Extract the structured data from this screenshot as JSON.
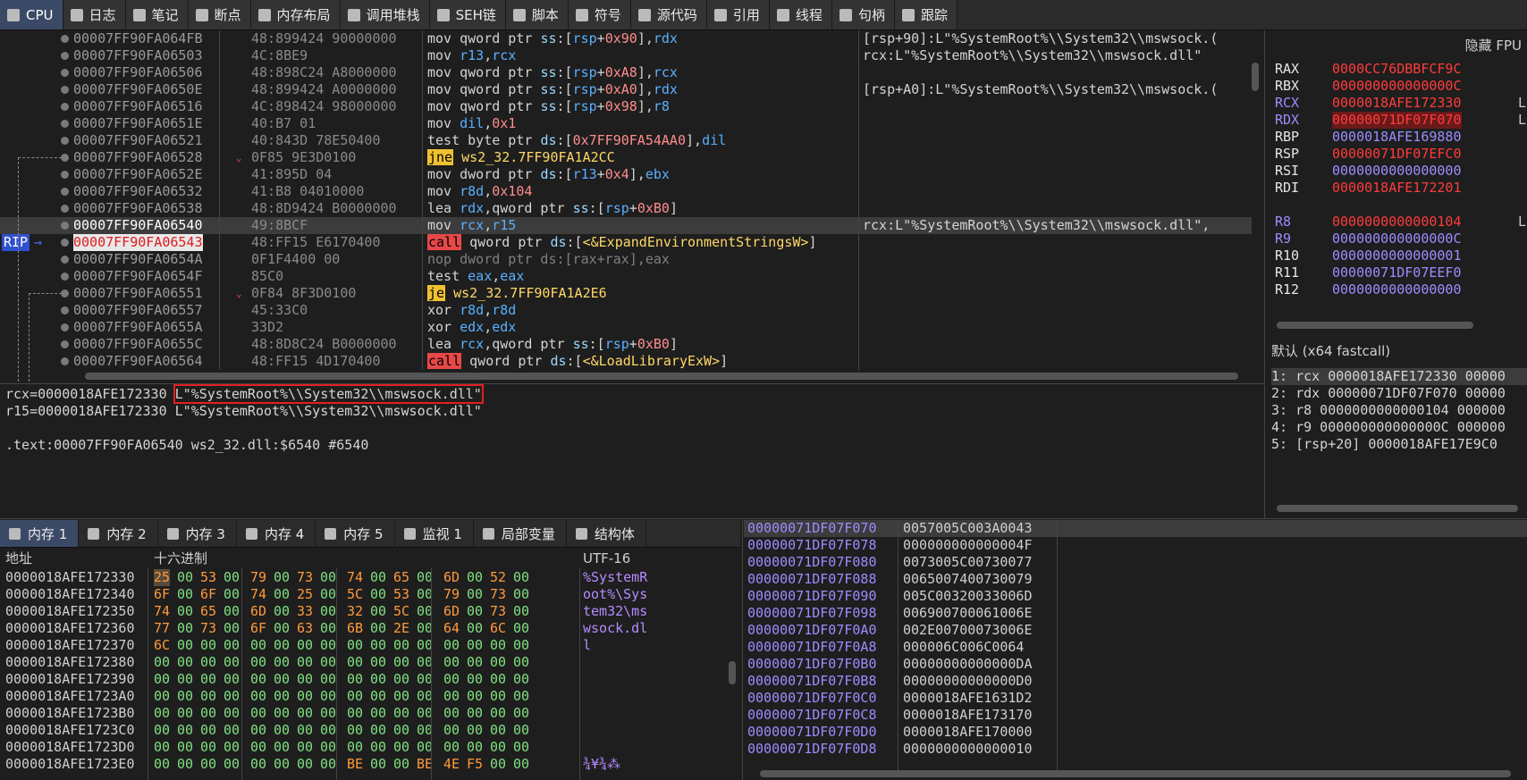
{
  "tabs": [
    {
      "label": "CPU",
      "icon": "cpu-icon",
      "active": true
    },
    {
      "label": "日志",
      "icon": "log-icon"
    },
    {
      "label": "笔记",
      "icon": "notes-icon"
    },
    {
      "label": "断点",
      "icon": "breakpoint-icon"
    },
    {
      "label": "内存布局",
      "icon": "memory-map-icon"
    },
    {
      "label": "调用堆栈",
      "icon": "call-stack-icon"
    },
    {
      "label": "SEH链",
      "icon": "seh-icon"
    },
    {
      "label": "脚本",
      "icon": "script-icon"
    },
    {
      "label": "符号",
      "icon": "symbol-icon"
    },
    {
      "label": "源代码",
      "icon": "source-icon"
    },
    {
      "label": "引用",
      "icon": "reference-icon"
    },
    {
      "label": "线程",
      "icon": "thread-icon"
    },
    {
      "label": "句柄",
      "icon": "handle-icon"
    },
    {
      "label": "跟踪",
      "icon": "trace-icon"
    }
  ],
  "disasm": [
    {
      "addr": "00007FF90FA064FB",
      "bytes": "48:899424 90000000",
      "instr": [
        [
          "mn",
          "mov "
        ],
        [
          "mn",
          "qword ptr "
        ],
        [
          "op-seg",
          "ss"
        ],
        [
          "mn",
          ":["
        ],
        [
          "op-reg",
          "rsp"
        ],
        [
          "mn",
          "+"
        ],
        [
          "op-num",
          "0x90"
        ],
        [
          "mn",
          "],"
        ],
        [
          "op-reg",
          "rdx"
        ]
      ],
      "comment": "[rsp+90]:L\"%SystemRoot%\\\\System32\\\\mswsock.("
    },
    {
      "addr": "00007FF90FA06503",
      "bytes": "4C:8BE9",
      "instr": [
        [
          "mn",
          "mov "
        ],
        [
          "op-reg",
          "r13"
        ],
        [
          "mn",
          ","
        ],
        [
          "op-reg",
          "rcx"
        ]
      ],
      "comment": "rcx:L\"%SystemRoot%\\\\System32\\\\mswsock.dll\""
    },
    {
      "addr": "00007FF90FA06506",
      "bytes": "48:898C24 A8000000",
      "instr": [
        [
          "mn",
          "mov "
        ],
        [
          "mn",
          "qword ptr "
        ],
        [
          "op-seg",
          "ss"
        ],
        [
          "mn",
          ":["
        ],
        [
          "op-reg",
          "rsp"
        ],
        [
          "mn",
          "+"
        ],
        [
          "op-num",
          "0xA8"
        ],
        [
          "mn",
          "],"
        ],
        [
          "op-reg",
          "rcx"
        ]
      ],
      "comment": ""
    },
    {
      "addr": "00007FF90FA0650E",
      "bytes": "48:899424 A0000000",
      "instr": [
        [
          "mn",
          "mov "
        ],
        [
          "mn",
          "qword ptr "
        ],
        [
          "op-seg",
          "ss"
        ],
        [
          "mn",
          ":["
        ],
        [
          "op-reg",
          "rsp"
        ],
        [
          "mn",
          "+"
        ],
        [
          "op-num",
          "0xA0"
        ],
        [
          "mn",
          "],"
        ],
        [
          "op-reg",
          "rdx"
        ]
      ],
      "comment": "[rsp+A0]:L\"%SystemRoot%\\\\System32\\\\mswsock.("
    },
    {
      "addr": "00007FF90FA06516",
      "bytes": "4C:898424 98000000",
      "instr": [
        [
          "mn",
          "mov "
        ],
        [
          "mn",
          "qword ptr "
        ],
        [
          "op-seg",
          "ss"
        ],
        [
          "mn",
          ":["
        ],
        [
          "op-reg",
          "rsp"
        ],
        [
          "mn",
          "+"
        ],
        [
          "op-num",
          "0x98"
        ],
        [
          "mn",
          "],"
        ],
        [
          "op-reg",
          "r8"
        ]
      ],
      "comment": ""
    },
    {
      "addr": "00007FF90FA0651E",
      "bytes": "40:B7 01",
      "instr": [
        [
          "mn",
          "mov "
        ],
        [
          "op-reg",
          "dil"
        ],
        [
          "mn",
          ","
        ],
        [
          "op-num",
          "0x1"
        ]
      ],
      "comment": ""
    },
    {
      "addr": "00007FF90FA06521",
      "bytes": "40:843D 78E50400",
      "instr": [
        [
          "mn",
          "test "
        ],
        [
          "mn",
          "byte ptr "
        ],
        [
          "op-seg",
          "ds"
        ],
        [
          "mn",
          ":["
        ],
        [
          "op-num",
          "0x7FF90FA54AA0"
        ],
        [
          "mn",
          "],"
        ],
        [
          "op-reg",
          "dil"
        ]
      ],
      "comment": ""
    },
    {
      "addr": "00007FF90FA06528",
      "bytes": "0F85 9E3D0100",
      "instr": [
        [
          "mn-ctrl",
          "jne"
        ],
        [
          "mn",
          " "
        ],
        [
          "op-yellow",
          "ws2_32.7FF90FA1A2CC"
        ]
      ],
      "comment": "",
      "arrow": "down"
    },
    {
      "addr": "00007FF90FA0652E",
      "bytes": "41:895D 04",
      "instr": [
        [
          "mn",
          "mov "
        ],
        [
          "mn",
          "dword ptr "
        ],
        [
          "op-seg",
          "ds"
        ],
        [
          "mn",
          ":["
        ],
        [
          "op-reg",
          "r13"
        ],
        [
          "mn",
          "+"
        ],
        [
          "op-num",
          "0x4"
        ],
        [
          "mn",
          "],"
        ],
        [
          "op-reg",
          "ebx"
        ]
      ],
      "comment": ""
    },
    {
      "addr": "00007FF90FA06532",
      "bytes": "41:B8 04010000",
      "instr": [
        [
          "mn",
          "mov "
        ],
        [
          "op-reg",
          "r8d"
        ],
        [
          "mn",
          ","
        ],
        [
          "op-num",
          "0x104"
        ]
      ],
      "comment": ""
    },
    {
      "addr": "00007FF90FA06538",
      "bytes": "48:8D9424 B0000000",
      "instr": [
        [
          "mn",
          "lea "
        ],
        [
          "op-reg",
          "rdx"
        ],
        [
          "mn",
          ",qword ptr "
        ],
        [
          "op-seg",
          "ss"
        ],
        [
          "mn",
          ":["
        ],
        [
          "op-reg",
          "rsp"
        ],
        [
          "mn",
          "+"
        ],
        [
          "op-num",
          "0xB0"
        ],
        [
          "mn",
          "]"
        ]
      ],
      "comment": ""
    },
    {
      "addr": "00007FF90FA06540",
      "bytes": "49:8BCF",
      "instr": [
        [
          "mn",
          "mov "
        ],
        [
          "op-reg",
          "rcx"
        ],
        [
          "mn",
          ","
        ],
        [
          "op-reg",
          "r15"
        ]
      ],
      "comment": "rcx:L\"%SystemRoot%\\\\System32\\\\mswsock.dll\",",
      "selected": true
    },
    {
      "addr": "00007FF90FA06543",
      "bytes": "48:FF15 E6170400",
      "instr": [
        [
          "mn-call",
          "call"
        ],
        [
          "mn",
          " qword ptr "
        ],
        [
          "op-seg",
          "ds"
        ],
        [
          "mn",
          ":["
        ],
        [
          "op-yellow",
          "<&ExpandEnvironmentStringsW>"
        ],
        [
          "mn",
          "]"
        ]
      ],
      "comment": "",
      "rip": true
    },
    {
      "addr": "00007FF90FA0654A",
      "bytes": "0F1F4400 00",
      "instr": [
        [
          "mn-gray",
          "nop dword ptr ds:[rax+rax],eax"
        ]
      ],
      "comment": ""
    },
    {
      "addr": "00007FF90FA0654F",
      "bytes": "85C0",
      "instr": [
        [
          "mn",
          "test "
        ],
        [
          "op-reg",
          "eax"
        ],
        [
          "mn",
          ","
        ],
        [
          "op-reg",
          "eax"
        ]
      ],
      "comment": ""
    },
    {
      "addr": "00007FF90FA06551",
      "bytes": "0F84 8F3D0100",
      "instr": [
        [
          "mn-ctrl",
          "je"
        ],
        [
          "mn",
          " "
        ],
        [
          "op-yellow",
          "ws2_32.7FF90FA1A2E6"
        ]
      ],
      "comment": "",
      "arrow": "down"
    },
    {
      "addr": "00007FF90FA06557",
      "bytes": "45:33C0",
      "instr": [
        [
          "mn",
          "xor "
        ],
        [
          "op-reg",
          "r8d"
        ],
        [
          "mn",
          ","
        ],
        [
          "op-reg",
          "r8d"
        ]
      ],
      "comment": ""
    },
    {
      "addr": "00007FF90FA0655A",
      "bytes": "33D2",
      "instr": [
        [
          "mn",
          "xor "
        ],
        [
          "op-reg",
          "edx"
        ],
        [
          "mn",
          ","
        ],
        [
          "op-reg",
          "edx"
        ]
      ],
      "comment": ""
    },
    {
      "addr": "00007FF90FA0655C",
      "bytes": "48:8D8C24 B0000000",
      "instr": [
        [
          "mn",
          "lea "
        ],
        [
          "op-reg",
          "rcx"
        ],
        [
          "mn",
          ",qword ptr "
        ],
        [
          "op-seg",
          "ss"
        ],
        [
          "mn",
          ":["
        ],
        [
          "op-reg",
          "rsp"
        ],
        [
          "mn",
          "+"
        ],
        [
          "op-num",
          "0xB0"
        ],
        [
          "mn",
          "]"
        ]
      ],
      "comment": ""
    },
    {
      "addr": "00007FF90FA06564",
      "bytes": "48:FF15 4D170400",
      "instr": [
        [
          "mn-call",
          "call"
        ],
        [
          "mn",
          " qword ptr "
        ],
        [
          "op-seg",
          "ds"
        ],
        [
          "mn",
          ":["
        ],
        [
          "op-yellow",
          "<&LoadLibraryExW>"
        ],
        [
          "mn",
          "]"
        ]
      ],
      "comment": ""
    }
  ],
  "rip_label": "RIP",
  "info": {
    "line1_a": "rcx=0000018AFE172330 ",
    "line1_b": "L\"%SystemRoot%\\\\System32\\\\mswsock.dll\"",
    "line2": "r15=0000018AFE172330 L\"%SystemRoot%\\\\System32\\\\mswsock.dll\"",
    "line3": ".text:00007FF90FA06540 ws2_32.dll:$6540 #6540"
  },
  "registers": {
    "header": "隐藏 FPU",
    "items": [
      {
        "name": "RAX",
        "value": "0000CC76DBBFCF9C",
        "mod": false,
        "ptr": false
      },
      {
        "name": "RBX",
        "value": "000000000000000C",
        "mod": false,
        "ptr": false
      },
      {
        "name": "RCX",
        "value": "0000018AFE172330",
        "mod": true,
        "ptr": false,
        "tail": "L"
      },
      {
        "name": "RDX",
        "value": "00000071DF07F070",
        "mod": true,
        "ptr": false,
        "hl": true,
        "tail": "L"
      },
      {
        "name": "RBP",
        "value": "0000018AFE169880",
        "mod": false,
        "ptr": true
      },
      {
        "name": "RSP",
        "value": "00000071DF07EFC0",
        "mod": false,
        "ptr": false
      },
      {
        "name": "RSI",
        "value": "0000000000000000",
        "mod": false,
        "ptr": true
      },
      {
        "name": "RDI",
        "value": "0000018AFE172201",
        "mod": false,
        "ptr": false
      },
      {
        "name": "",
        "value": "",
        "mod": false,
        "ptr": false
      },
      {
        "name": "R8",
        "value": "0000000000000104",
        "mod": true,
        "ptr": false,
        "tail": "L"
      },
      {
        "name": "R9",
        "value": "000000000000000C",
        "mod": true,
        "ptr": true
      },
      {
        "name": "R10",
        "value": "0000000000000001",
        "mod": false,
        "ptr": true
      },
      {
        "name": "R11",
        "value": "00000071DF07EEF0",
        "mod": false,
        "ptr": true
      },
      {
        "name": "R12",
        "value": "0000000000000000",
        "mod": false,
        "ptr": true
      }
    ]
  },
  "callconv": {
    "title": "默认 (x64 fastcall)",
    "args": [
      "1: rcx 0000018AFE172330 00000",
      "2: rdx 00000071DF07F070 00000",
      "3: r8 0000000000000104 000000",
      "4: r9 000000000000000C 000000",
      "5: [rsp+20] 0000018AFE17E9C0"
    ]
  },
  "mem_tabs": [
    {
      "label": "内存 1",
      "icon": "memory-icon",
      "active": true
    },
    {
      "label": "内存 2",
      "icon": "memory-icon"
    },
    {
      "label": "内存 3",
      "icon": "memory-icon"
    },
    {
      "label": "内存 4",
      "icon": "memory-icon"
    },
    {
      "label": "内存 5",
      "icon": "memory-icon"
    },
    {
      "label": "监视 1",
      "icon": "watch-icon"
    },
    {
      "label": "局部变量",
      "icon": "locals-icon"
    },
    {
      "label": "结构体",
      "icon": "struct-icon"
    }
  ],
  "dump": {
    "col_addr": "地址",
    "col_hex": "十六进制",
    "col_text": "UTF-16",
    "rows": [
      {
        "a": "0000018AFE172330",
        "h": [
          "25",
          "00",
          "53",
          "00",
          "79",
          "00",
          "73",
          "00",
          "74",
          "00",
          "65",
          "00",
          "6D",
          "00",
          "52",
          "00"
        ],
        "t": "%SystemR"
      },
      {
        "a": "0000018AFE172340",
        "h": [
          "6F",
          "00",
          "6F",
          "00",
          "74",
          "00",
          "25",
          "00",
          "5C",
          "00",
          "53",
          "00",
          "79",
          "00",
          "73",
          "00"
        ],
        "t": "oot%\\Sys"
      },
      {
        "a": "0000018AFE172350",
        "h": [
          "74",
          "00",
          "65",
          "00",
          "6D",
          "00",
          "33",
          "00",
          "32",
          "00",
          "5C",
          "00",
          "6D",
          "00",
          "73",
          "00"
        ],
        "t": "tem32\\ms"
      },
      {
        "a": "0000018AFE172360",
        "h": [
          "77",
          "00",
          "73",
          "00",
          "6F",
          "00",
          "63",
          "00",
          "6B",
          "00",
          "2E",
          "00",
          "64",
          "00",
          "6C",
          "00"
        ],
        "t": "wsock.dl"
      },
      {
        "a": "0000018AFE172370",
        "h": [
          "6C",
          "00",
          "00",
          "00",
          "00",
          "00",
          "00",
          "00",
          "00",
          "00",
          "00",
          "00",
          "00",
          "00",
          "00",
          "00"
        ],
        "t": "l"
      },
      {
        "a": "0000018AFE172380",
        "h": [
          "00",
          "00",
          "00",
          "00",
          "00",
          "00",
          "00",
          "00",
          "00",
          "00",
          "00",
          "00",
          "00",
          "00",
          "00",
          "00"
        ],
        "t": ""
      },
      {
        "a": "0000018AFE172390",
        "h": [
          "00",
          "00",
          "00",
          "00",
          "00",
          "00",
          "00",
          "00",
          "00",
          "00",
          "00",
          "00",
          "00",
          "00",
          "00",
          "00"
        ],
        "t": ""
      },
      {
        "a": "0000018AFE1723A0",
        "h": [
          "00",
          "00",
          "00",
          "00",
          "00",
          "00",
          "00",
          "00",
          "00",
          "00",
          "00",
          "00",
          "00",
          "00",
          "00",
          "00"
        ],
        "t": ""
      },
      {
        "a": "0000018AFE1723B0",
        "h": [
          "00",
          "00",
          "00",
          "00",
          "00",
          "00",
          "00",
          "00",
          "00",
          "00",
          "00",
          "00",
          "00",
          "00",
          "00",
          "00"
        ],
        "t": ""
      },
      {
        "a": "0000018AFE1723C0",
        "h": [
          "00",
          "00",
          "00",
          "00",
          "00",
          "00",
          "00",
          "00",
          "00",
          "00",
          "00",
          "00",
          "00",
          "00",
          "00",
          "00"
        ],
        "t": ""
      },
      {
        "a": "0000018AFE1723D0",
        "h": [
          "00",
          "00",
          "00",
          "00",
          "00",
          "00",
          "00",
          "00",
          "00",
          "00",
          "00",
          "00",
          "00",
          "00",
          "00",
          "00"
        ],
        "t": ""
      },
      {
        "a": "0000018AFE1723E0",
        "h": [
          "00",
          "00",
          "00",
          "00",
          "00",
          "00",
          "00",
          "00",
          "BE",
          "00",
          "00",
          "BE",
          "4E",
          "F5",
          "00",
          "00"
        ],
        "t": "¾¥¾⁂"
      }
    ]
  },
  "stack": [
    {
      "a": "00000071DF07F070",
      "v": "0057005C003A0043"
    },
    {
      "a": "00000071DF07F078",
      "v": "000000000000004F"
    },
    {
      "a": "00000071DF07F080",
      "v": "0073005C00730077"
    },
    {
      "a": "00000071DF07F088",
      "v": "0065007400730079"
    },
    {
      "a": "00000071DF07F090",
      "v": "005C00320033006D"
    },
    {
      "a": "00000071DF07F098",
      "v": "006900700061006E"
    },
    {
      "a": "00000071DF07F0A0",
      "v": "002E00700073006E"
    },
    {
      "a": "00000071DF07F0A8",
      "v": "000006C006C0064"
    },
    {
      "a": "00000071DF07F0B0",
      "v": "00000000000000DA"
    },
    {
      "a": "00000071DF07F0B8",
      "v": "00000000000000D0"
    },
    {
      "a": "00000071DF07F0C0",
      "v": "0000018AFE1631D2"
    },
    {
      "a": "00000071DF07F0C8",
      "v": "0000018AFE173170"
    },
    {
      "a": "00000071DF07F0D0",
      "v": "0000018AFE170000"
    },
    {
      "a": "00000071DF07F0D8",
      "v": "0000000000000010"
    }
  ],
  "colors": {
    "accent": "#3a4a66",
    "highlight": "#e01b1b",
    "pointer": "#9d8cff"
  }
}
